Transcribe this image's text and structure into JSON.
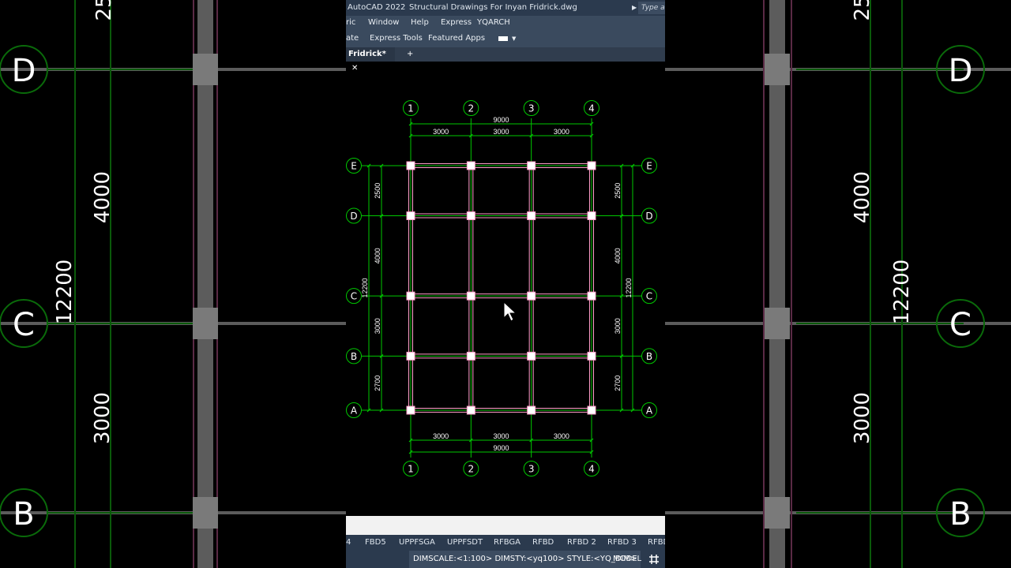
{
  "titlebar": {
    "app_name": "AutoCAD 2022",
    "file_name": "Structural Drawings For Inyan Fridrick.dwg",
    "search_placeholder": "Type a"
  },
  "menubar": [
    "ric",
    "Window",
    "Help",
    "Express",
    "YQARCH"
  ],
  "ribbon_tabs": [
    "ate",
    "Express Tools",
    "Featured Apps"
  ],
  "document_tab": {
    "label": "Fridrick*",
    "close": "✕",
    "add": "+"
  },
  "drawing": {
    "column_labels": [
      "1",
      "2",
      "3",
      "4"
    ],
    "row_labels": [
      "E",
      "D",
      "C",
      "B",
      "A"
    ],
    "column_spacing_mm": [
      3000,
      3000,
      3000
    ],
    "row_spacing_mm": [
      2500,
      4000,
      3000,
      2700
    ],
    "overall_width_mm": 9000,
    "overall_height_mm": 12200,
    "top_dims": {
      "total": "9000",
      "segments": [
        "3000",
        "3000",
        "3000"
      ]
    },
    "bottom_dims": {
      "total": "9000",
      "segments": [
        "3000",
        "3000",
        "3000"
      ]
    },
    "left_dims": {
      "total": "12200",
      "segments": [
        "2500",
        "4000",
        "3000",
        "2700"
      ]
    },
    "right_dims": {
      "total": "12200",
      "segments": [
        "2500",
        "4000",
        "3000",
        "2700"
      ]
    },
    "colors": {
      "axis": "#00c800",
      "beam": "#ff9ec8",
      "column": "#ffffff",
      "background": "#000000"
    }
  },
  "background_zoom": {
    "left_labels": [
      "D",
      "C",
      "B"
    ],
    "left_dims": [
      "25",
      "4000",
      "12200",
      "3000"
    ],
    "right_labels": [
      "D",
      "C",
      "B"
    ],
    "right_dims": [
      "25",
      "4000",
      "12200",
      "3000"
    ]
  },
  "layout_tabs": [
    "4",
    "FBD5",
    "UPPFSGA",
    "UPPFSDT",
    "RFBGA",
    "RFBD",
    "RFBD 2",
    "RFBD 3",
    "RFBD"
  ],
  "statusbar": {
    "dimscale": "DIMSCALE:<1:100> DIMSTY:<yq100> STYLE:<YQ_DIM>",
    "model": "MODEL",
    "grid_icon": "grid-icon"
  }
}
